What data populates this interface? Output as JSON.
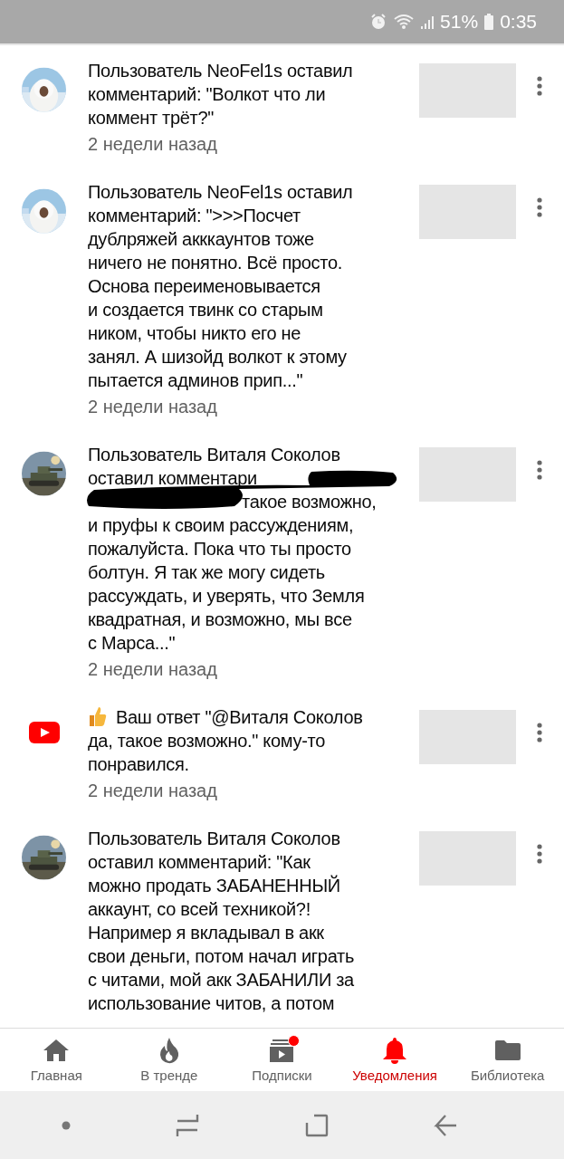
{
  "status_bar": {
    "battery": "51%",
    "time": "0:35"
  },
  "notifications": [
    {
      "kind": "comment",
      "redacted": false,
      "lines": [
        "Пользователь NeoFel1s оставил",
        "комментарий: \"Волкот что ли",
        "коммент трёт?\""
      ],
      "time": "2 недели назад"
    },
    {
      "kind": "comment",
      "redacted": false,
      "lines": [
        "Пользователь NeoFel1s оставил",
        "комментарий: \">>>Посчет",
        "дублряжей акккаунтов тоже",
        "ничего не понятно. Всё просто.",
        "Основа переименовывается",
        "и создается твинк со старым",
        "ником, чтобы никто его не",
        "занял. А шизойд волкот к этому",
        "пытается админов прип...\""
      ],
      "time": "2 недели назад"
    },
    {
      "kind": "comment",
      "redacted": true,
      "lines": [
        "Пользователь Виталя Соколов",
        "оставил комментари",
        "такое возможно,",
        "и пруфы к своим рассуждениям,",
        "пожалуйста. Пока что ты просто",
        "болтун. Я так же могу сидеть",
        "рассуждать, и уверять, что Земля",
        "квадратная, и возможно, мы все",
        "с Марса...\""
      ],
      "time": "2 недели назад"
    },
    {
      "kind": "like",
      "redacted": false,
      "lines": [
        "Ваш ответ \"@Виталя Соколов",
        "да, такое возможно.\" кому-то",
        "понравился."
      ],
      "time": "2 недели назад"
    },
    {
      "kind": "comment",
      "redacted": false,
      "lines": [
        "Пользователь Виталя Соколов",
        "оставил комментарий: \"Как",
        "можно продать ЗАБАНЕННЫЙ",
        "аккаунт, со всей техникой?!",
        "Например я вкладывал в акк",
        "свои деньги, потом начал играть",
        "с читами, мой акк ЗАБАНИЛИ за",
        "использование читов, а потом"
      ]
    }
  ],
  "bottom_nav": [
    {
      "label": "Главная",
      "selected": false,
      "badge": false
    },
    {
      "label": "В тренде",
      "selected": false,
      "badge": false
    },
    {
      "label": "Подписки",
      "selected": false,
      "badge": true
    },
    {
      "label": "Уведомления",
      "selected": true,
      "badge": false
    },
    {
      "label": "Библиотека",
      "selected": false,
      "badge": false
    }
  ]
}
